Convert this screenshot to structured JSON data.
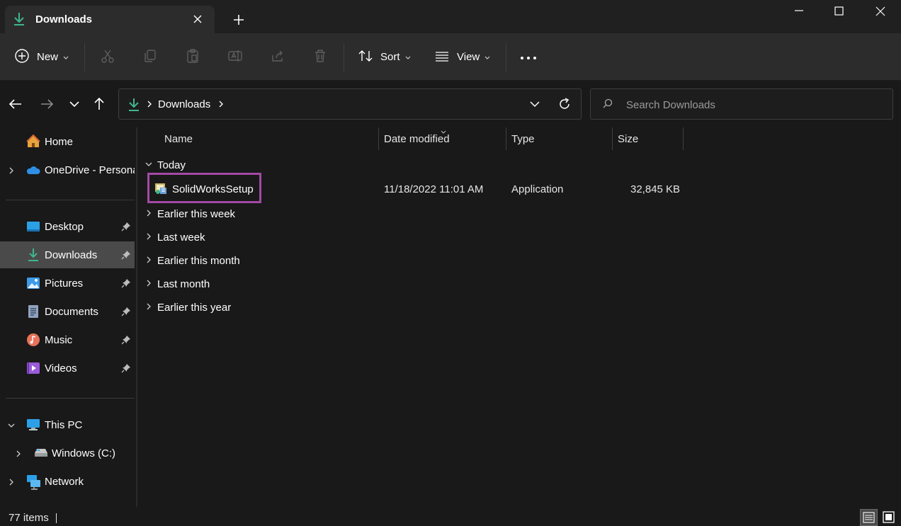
{
  "window": {
    "tab_title": "Downloads"
  },
  "toolbar": {
    "new_label": "New",
    "sort_label": "Sort",
    "view_label": "View"
  },
  "address": {
    "crumb": "Downloads"
  },
  "search": {
    "placeholder": "Search Downloads"
  },
  "sidebar": {
    "items": [
      {
        "label": "Home",
        "icon": "home-icon"
      },
      {
        "label": "OneDrive - Persona",
        "icon": "onedrive-icon"
      },
      {
        "label": "Desktop",
        "icon": "desktop-icon"
      },
      {
        "label": "Downloads",
        "icon": "download-icon"
      },
      {
        "label": "Pictures",
        "icon": "pictures-icon"
      },
      {
        "label": "Documents",
        "icon": "documents-icon"
      },
      {
        "label": "Music",
        "icon": "music-icon"
      },
      {
        "label": "Videos",
        "icon": "videos-icon"
      },
      {
        "label": "This PC",
        "icon": "this-pc-icon"
      },
      {
        "label": "Windows (C:)",
        "icon": "drive-icon"
      },
      {
        "label": "Network",
        "icon": "network-icon"
      }
    ]
  },
  "columns": {
    "name": "Name",
    "date": "Date modified",
    "type": "Type",
    "size": "Size"
  },
  "groups": {
    "today": "Today",
    "earlier_this_week": "Earlier this week",
    "last_week": "Last week",
    "earlier_this_month": "Earlier this month",
    "last_month": "Last month",
    "earlier_this_year": "Earlier this year"
  },
  "files": [
    {
      "name": "SolidWorksSetup",
      "date": "11/18/2022 11:01 AM",
      "type": "Application",
      "size": "32,845 KB"
    }
  ],
  "status": {
    "item_count": "77 items"
  },
  "colors": {
    "accent_green": "#3fb68b",
    "highlight_box": "#a349a4",
    "selected_bg": "#4a4a4a"
  }
}
